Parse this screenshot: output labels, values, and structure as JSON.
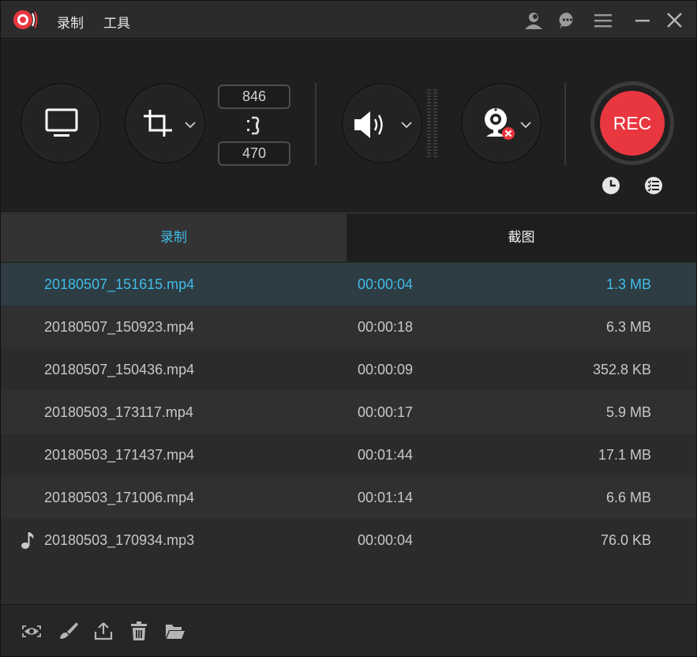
{
  "menu": {
    "record": "录制",
    "tools": "工具"
  },
  "dimensions": {
    "width": "846",
    "height": "470"
  },
  "rec_button": {
    "label": "REC"
  },
  "tabs": {
    "record": "录制",
    "screenshot": "截图"
  },
  "files": [
    {
      "name": "20180507_151615.mp4",
      "duration": "00:00:04",
      "size": "1.3 MB",
      "type": "video",
      "selected": true
    },
    {
      "name": "20180507_150923.mp4",
      "duration": "00:00:18",
      "size": "6.3 MB",
      "type": "video",
      "selected": false
    },
    {
      "name": "20180507_150436.mp4",
      "duration": "00:00:09",
      "size": "352.8 KB",
      "type": "video",
      "selected": false
    },
    {
      "name": "20180503_173117.mp4",
      "duration": "00:00:17",
      "size": "5.9 MB",
      "type": "video",
      "selected": false
    },
    {
      "name": "20180503_171437.mp4",
      "duration": "00:01:44",
      "size": "17.1 MB",
      "type": "video",
      "selected": false
    },
    {
      "name": "20180503_171006.mp4",
      "duration": "00:01:14",
      "size": "6.6 MB",
      "type": "video",
      "selected": false
    },
    {
      "name": "20180503_170934.mp3",
      "duration": "00:00:04",
      "size": "76.0 KB",
      "type": "audio",
      "selected": false
    }
  ],
  "icons": {
    "titlebar": [
      "app-logo-icon",
      "user-icon",
      "chat-icon",
      "hamburger-menu-icon",
      "minimize-icon",
      "close-icon"
    ],
    "toolbar": [
      "monitor-icon",
      "crop-icon",
      "link-icon",
      "speaker-icon",
      "webcam-icon",
      "clock-icon",
      "task-list-icon"
    ],
    "bottom": [
      "eye-icon",
      "brush-icon",
      "share-icon",
      "trash-icon",
      "folder-icon"
    ]
  },
  "colors": {
    "accent": "#3fbde8",
    "rec": "#e8373f",
    "webcam_off": "#e8373f"
  }
}
